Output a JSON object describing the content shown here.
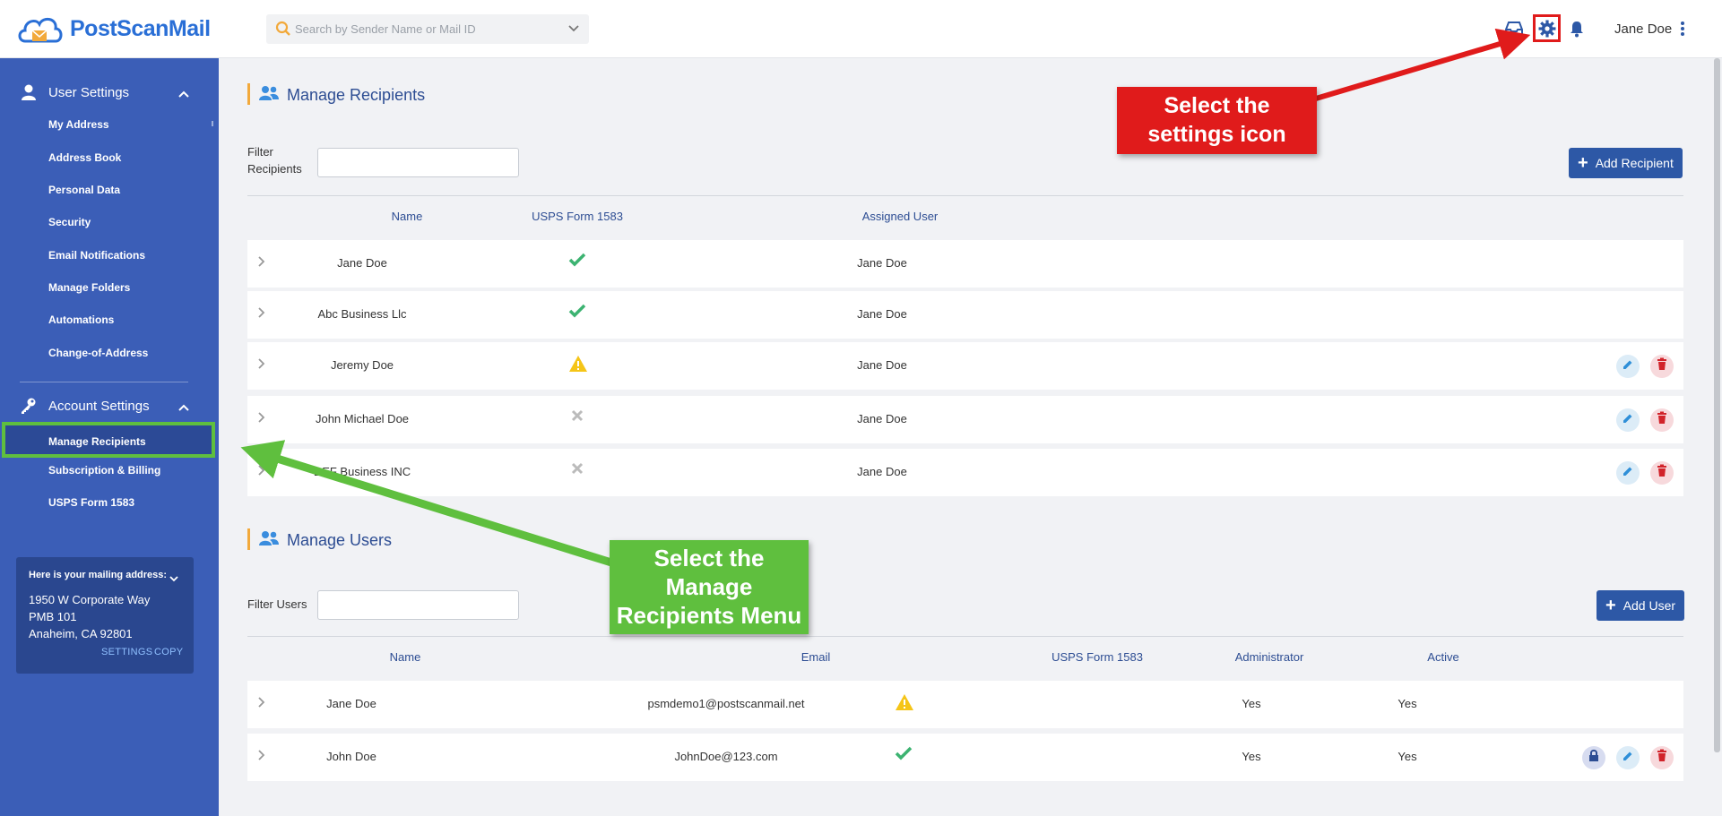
{
  "header": {
    "logo_text": "PostScanMail",
    "search_placeholder": "Search by Sender Name or Mail ID",
    "user_name": "Jane Doe"
  },
  "sidebar": {
    "user_settings": {
      "label": "User Settings",
      "items": [
        "My Address",
        "Address Book",
        "Personal Data",
        "Security",
        "Email Notifications",
        "Manage Folders",
        "Automations",
        "Change-of-Address"
      ]
    },
    "account_settings": {
      "label": "Account Settings",
      "items": [
        "Manage Recipients",
        "Subscription & Billing",
        "USPS Form 1583"
      ]
    },
    "address_card": {
      "title": "Here is your mailing address:",
      "line1": "1950 W Corporate Way",
      "line2": "PMB 101",
      "line3": "Anaheim, CA 92801",
      "settings_link": "SETTINGS",
      "copy_link": "COPY"
    }
  },
  "recipients": {
    "title": "Manage Recipients",
    "filter_label_1": "Filter",
    "filter_label_2": "Recipients",
    "add_label": "Add Recipient",
    "columns": {
      "name": "Name",
      "form": "USPS Form 1583",
      "user": "Assigned User"
    },
    "rows": [
      {
        "name": "Jane Doe",
        "form_status": "check",
        "user": "Jane Doe",
        "actions": false
      },
      {
        "name": "Abc Business Llc",
        "form_status": "check",
        "user": "Jane Doe",
        "actions": false
      },
      {
        "name": "Jeremy Doe",
        "form_status": "warning",
        "user": "Jane Doe",
        "actions": true
      },
      {
        "name": "John Michael Doe",
        "form_status": "cross",
        "user": "Jane Doe",
        "actions": true
      },
      {
        "name": "DEF Business INC",
        "form_status": "cross",
        "user": "Jane Doe",
        "actions": true
      }
    ]
  },
  "users": {
    "title": "Manage Users",
    "filter_label": "Filter Users",
    "add_label": "Add User",
    "columns": {
      "name": "Name",
      "email": "Email",
      "form": "USPS Form 1583",
      "admin": "Administrator",
      "active": "Active"
    },
    "rows": [
      {
        "name": "Jane Doe",
        "email": "psmdemo1@postscanmail.net",
        "form_status": "warning",
        "admin": "Yes",
        "active": "Yes"
      },
      {
        "name": "John Doe",
        "email": "JohnDoe@123.com",
        "form_status": "check",
        "admin": "Yes",
        "active": "Yes"
      }
    ]
  },
  "annotations": {
    "settings_callout_1": "Select the",
    "settings_callout_2": "settings icon",
    "menu_callout_1": "Select the",
    "menu_callout_2": "Manage",
    "menu_callout_3": "Recipients Menu"
  },
  "colors": {
    "sidebar": "#3b5eb7",
    "primary": "#2d58a6",
    "check": "#3cb371",
    "warning": "#f5c518",
    "annotation_red": "#e01b1b",
    "annotation_green": "#5fbf3e"
  }
}
